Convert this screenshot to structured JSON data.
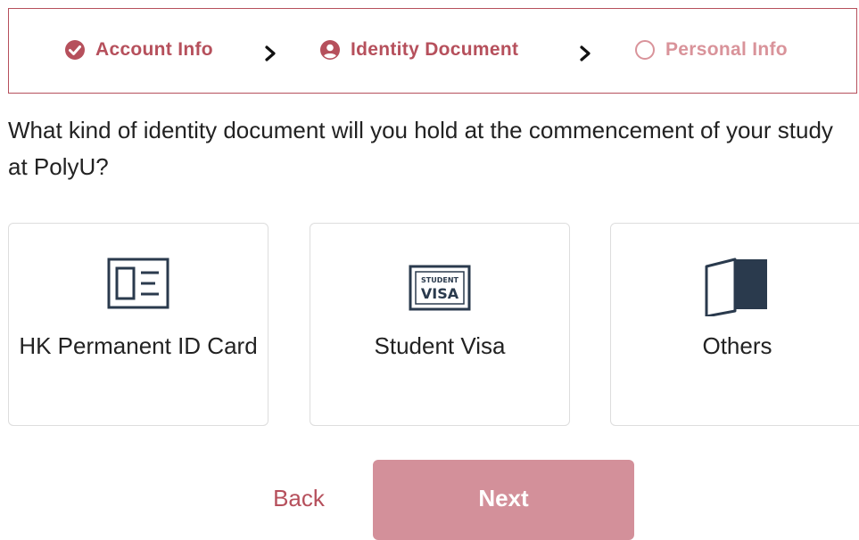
{
  "stepper": {
    "steps": [
      {
        "label": "Account Info",
        "state": "completed",
        "icon": "check-circle-icon"
      },
      {
        "label": "Identity Document",
        "state": "current",
        "icon": "user-circle-icon"
      },
      {
        "label": "Personal Info",
        "state": "pending",
        "icon": "empty-circle-icon"
      }
    ],
    "separator_icon": "chevron-right-icon"
  },
  "question": "What kind of identity document will you hold at the commencement of your study at PolyU?",
  "options": [
    {
      "label": "HK Permanent ID Card",
      "icon": "id-card-icon"
    },
    {
      "label": "Student Visa",
      "icon": "student-visa-icon",
      "icon_text_top": "STUDENT",
      "icon_text_bottom": "VISA"
    },
    {
      "label": "Others",
      "icon": "half-open-door-icon"
    }
  ],
  "actions": {
    "back_label": "Back",
    "next_label": "Next"
  },
  "colors": {
    "accent": "#b6505c",
    "pending": "#d9939a",
    "next_button": "#d3909a",
    "icon": "#2a3a4d",
    "border": "#dddddd"
  }
}
